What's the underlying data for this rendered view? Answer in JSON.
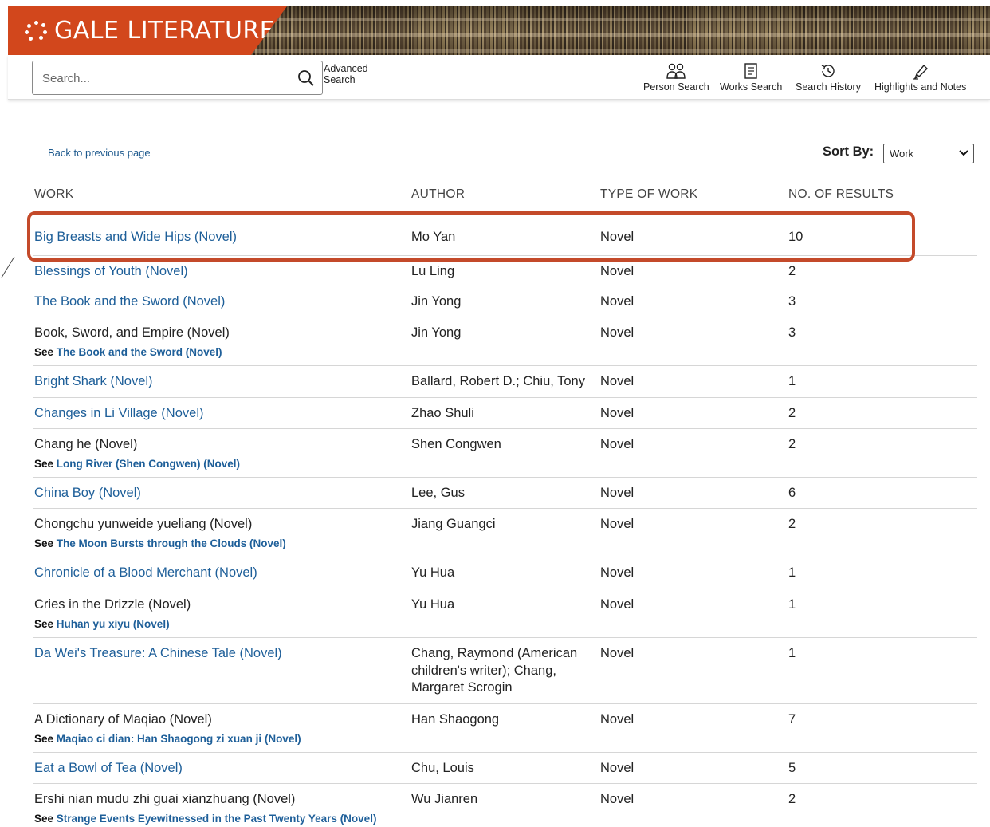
{
  "brand": {
    "name": "GALE LITERATURE",
    "accent_color": "#d2471c"
  },
  "search": {
    "placeholder": "Search...",
    "value": "",
    "icon": "search-icon",
    "advanced_label_line1": "Advanced",
    "advanced_label_line2": "Search"
  },
  "tools": [
    {
      "label": "Person Search",
      "icon": "person-search-icon"
    },
    {
      "label": "Works Search",
      "icon": "works-search-icon"
    },
    {
      "label": "Search History",
      "icon": "history-icon"
    },
    {
      "label": "Highlights and Notes",
      "icon": "highlighter-icon"
    }
  ],
  "back_link": "Back to previous page",
  "sort": {
    "label": "Sort By:",
    "selected": "Work"
  },
  "columns": {
    "work": "WORK",
    "author": "AUTHOR",
    "type": "TYPE OF WORK",
    "results": "NO. OF RESULTS"
  },
  "rows": [
    {
      "work": "Big Breasts and Wide Hips (Novel)",
      "linked": true,
      "author": "Mo Yan",
      "type": "Novel",
      "results": "10"
    },
    {
      "work": "Blessings of Youth (Novel)",
      "linked": true,
      "author": "Lu Ling",
      "type": "Novel",
      "results": "2"
    },
    {
      "work": "The Book and the Sword (Novel)",
      "linked": true,
      "author": "Jin Yong",
      "type": "Novel",
      "results": "3"
    },
    {
      "work": "Book, Sword, and Empire (Novel)",
      "linked": false,
      "see_prefix": "See",
      "see": "The Book and the Sword (Novel)",
      "author": "Jin Yong",
      "type": "Novel",
      "results": "3"
    },
    {
      "work": "Bright Shark (Novel)",
      "linked": true,
      "author": "Ballard, Robert D.; Chiu, Tony",
      "type": "Novel",
      "results": "1"
    },
    {
      "work": "Changes in Li Village (Novel)",
      "linked": true,
      "author": "Zhao Shuli",
      "type": "Novel",
      "results": "2"
    },
    {
      "work": "Chang he (Novel)",
      "linked": false,
      "see_prefix": "See",
      "see": "Long River (Shen Congwen) (Novel)",
      "author": "Shen Congwen",
      "type": "Novel",
      "results": "2"
    },
    {
      "work": "China Boy (Novel)",
      "linked": true,
      "author": "Lee, Gus",
      "type": "Novel",
      "results": "6"
    },
    {
      "work": "Chongchu yunweide yueliang (Novel)",
      "linked": false,
      "see_prefix": "See",
      "see": "The Moon Bursts through the Clouds (Novel)",
      "author": "Jiang Guangci",
      "type": "Novel",
      "results": "2"
    },
    {
      "work": "Chronicle of a Blood Merchant (Novel)",
      "linked": true,
      "author": "Yu Hua",
      "type": "Novel",
      "results": "1"
    },
    {
      "work": "Cries in the Drizzle (Novel)",
      "linked": false,
      "see_prefix": "See",
      "see": "Huhan yu xiyu (Novel)",
      "author": "Yu Hua",
      "type": "Novel",
      "results": "1"
    },
    {
      "work": "Da Wei's Treasure: A Chinese Tale (Novel)",
      "linked": true,
      "author": "Chang, Raymond (American children's writer); Chang, Margaret Scrogin",
      "type": "Novel",
      "results": "1"
    },
    {
      "work": "A Dictionary of Maqiao (Novel)",
      "linked": false,
      "see_prefix": "See",
      "see": "Maqiao ci dian: Han Shaogong zi xuan ji (Novel)",
      "author": "Han Shaogong",
      "type": "Novel",
      "results": "7"
    },
    {
      "work": "Eat a Bowl of Tea (Novel)",
      "linked": true,
      "author": "Chu, Louis",
      "type": "Novel",
      "results": "5"
    },
    {
      "work": "Ershi nian mudu zhi guai xianzhuang (Novel)",
      "linked": false,
      "see_prefix": "See",
      "see": "Strange Events Eyewitnessed in the Past Twenty Years (Novel)",
      "author": "Wu Jianren",
      "type": "Novel",
      "results": "2"
    }
  ]
}
